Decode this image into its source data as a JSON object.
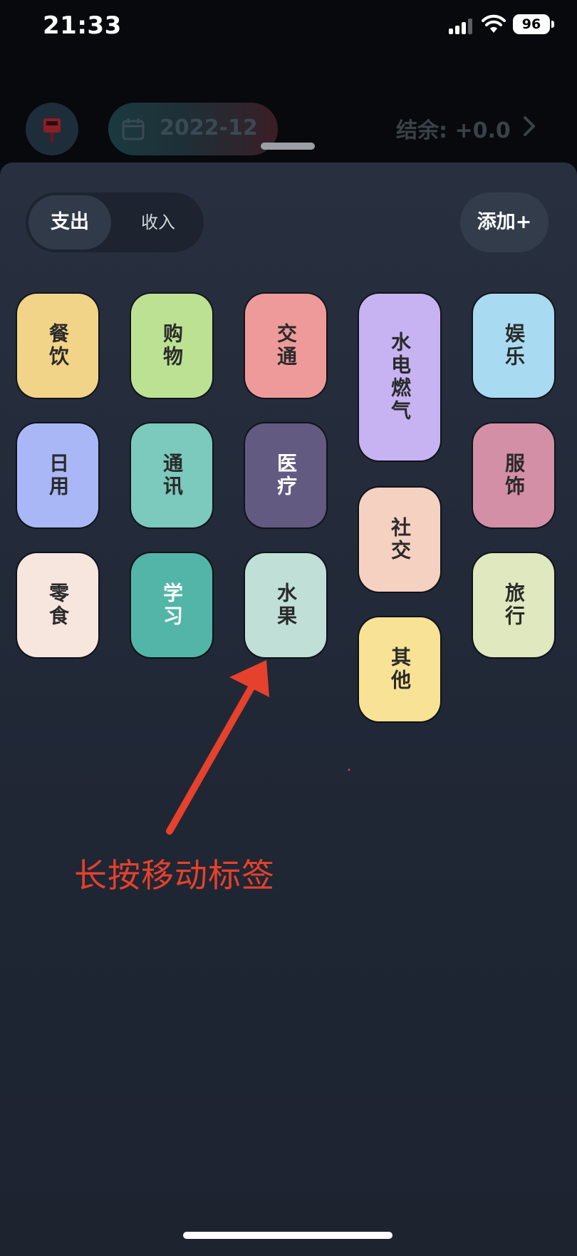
{
  "status_bar": {
    "time": "21:33",
    "battery": "96"
  },
  "header": {
    "date": "2022-12",
    "balance": "结余: +0.0",
    "icon": "mailbox-icon"
  },
  "sheet": {
    "tabs": {
      "expense": "支出",
      "income": "收入",
      "selected": "支出"
    },
    "add_label": "添加+",
    "tags": [
      {
        "label": "餐饮",
        "color": "#f1d488"
      },
      {
        "label": "购物",
        "color": "#bde193"
      },
      {
        "label": "交通",
        "color": "#ef9a9a"
      },
      {
        "label": "水电燃气",
        "color": "#c7b3f1"
      },
      {
        "label": "娱乐",
        "color": "#a8dbf1"
      },
      {
        "label": "日用",
        "color": "#a9b7f7"
      },
      {
        "label": "通讯",
        "color": "#7cc9be"
      },
      {
        "label": "医疗",
        "color": "#635a82"
      },
      {
        "label": "服饰",
        "color": "#d38fa6"
      },
      {
        "label": "社交",
        "color": "#f5d1c2"
      },
      {
        "label": "零食",
        "color": "#f7e6de"
      },
      {
        "label": "学习",
        "color": "#52b5a8"
      },
      {
        "label": "水果",
        "color": "#c0dfd6"
      },
      {
        "label": "旅行",
        "color": "#dfe8bf"
      },
      {
        "label": "其他",
        "color": "#f8e295"
      }
    ]
  },
  "annotation": {
    "text": "长按移动标签",
    "color": "#e5412c"
  }
}
